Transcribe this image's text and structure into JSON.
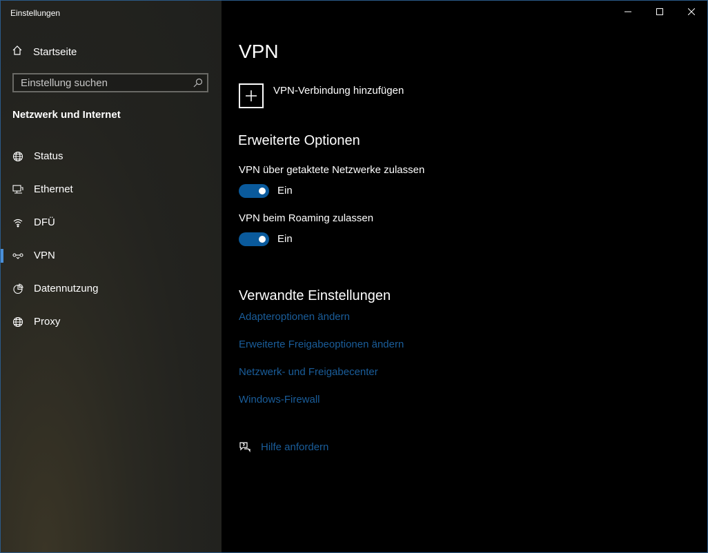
{
  "window": {
    "title": "Einstellungen"
  },
  "sidebar": {
    "home_label": "Startseite",
    "search_placeholder": "Einstellung suchen",
    "section_title": "Netzwerk und Internet",
    "items": [
      {
        "label": "Status",
        "icon": "globe-status-icon"
      },
      {
        "label": "Ethernet",
        "icon": "ethernet-icon"
      },
      {
        "label": "DFÜ",
        "icon": "dialup-icon"
      },
      {
        "label": "VPN",
        "icon": "vpn-icon",
        "selected": true
      },
      {
        "label": "Datennutzung",
        "icon": "data-usage-icon"
      },
      {
        "label": "Proxy",
        "icon": "globe-icon"
      }
    ]
  },
  "main": {
    "title": "VPN",
    "add_vpn_label": "VPN-Verbindung hinzufügen",
    "advanced": {
      "heading": "Erweiterte Optionen",
      "options": [
        {
          "label": "VPN über getaktete Netzwerke zulassen",
          "state": "Ein",
          "on": true
        },
        {
          "label": "VPN beim Roaming zulassen",
          "state": "Ein",
          "on": true
        }
      ]
    },
    "related": {
      "heading": "Verwandte Einstellungen",
      "links": [
        "Adapteroptionen ändern",
        "Erweiterte Freigabeoptionen ändern",
        "Netzwerk- und Freigabecenter",
        "Windows-Firewall"
      ]
    },
    "help_label": "Hilfe anfordern"
  },
  "colors": {
    "accent": "#0a5a9c",
    "link": "#1a5d9a",
    "selection_bar": "#4a90d9"
  }
}
